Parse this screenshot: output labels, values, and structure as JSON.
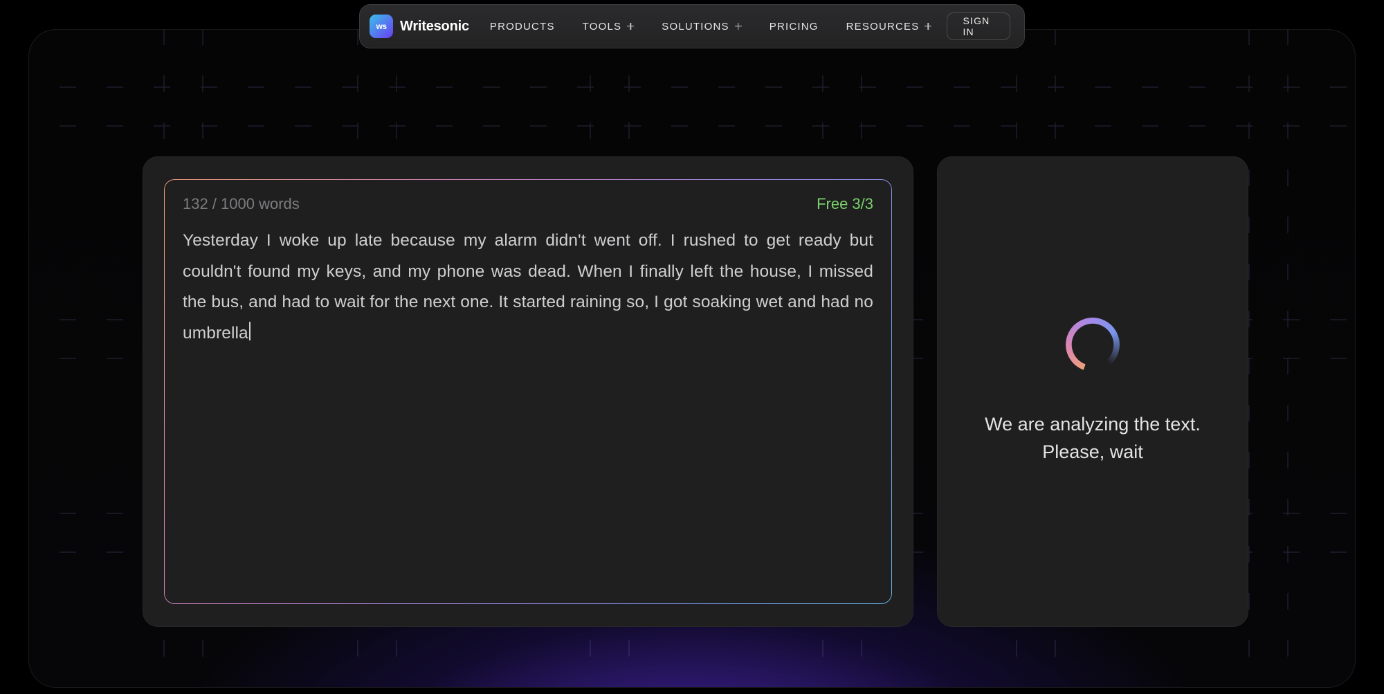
{
  "brand": {
    "badge": "ws",
    "name": "Writesonic"
  },
  "nav": {
    "items": [
      {
        "label": "PRODUCTS",
        "hasMenu": false
      },
      {
        "label": "TOOLS",
        "hasMenu": true
      },
      {
        "label": "SOLUTIONS",
        "hasMenu": true
      },
      {
        "label": "PRICING",
        "hasMenu": false
      },
      {
        "label": "RESOURCES",
        "hasMenu": true
      }
    ],
    "signin": "SIGN IN"
  },
  "editor": {
    "word_count": "132 / 1000 words",
    "free_tag": "Free 3/3",
    "text": "Yesterday I woke up late because my alarm didn't went off. I rushed to get ready but couldn't found my keys, and my phone was dead. When I finally left the house, I missed the bus, and had to wait for the next one. It started raining so, I got soaking wet and had no umbrella"
  },
  "side": {
    "analyzing": "We are analyzing the text. Please, wait"
  }
}
